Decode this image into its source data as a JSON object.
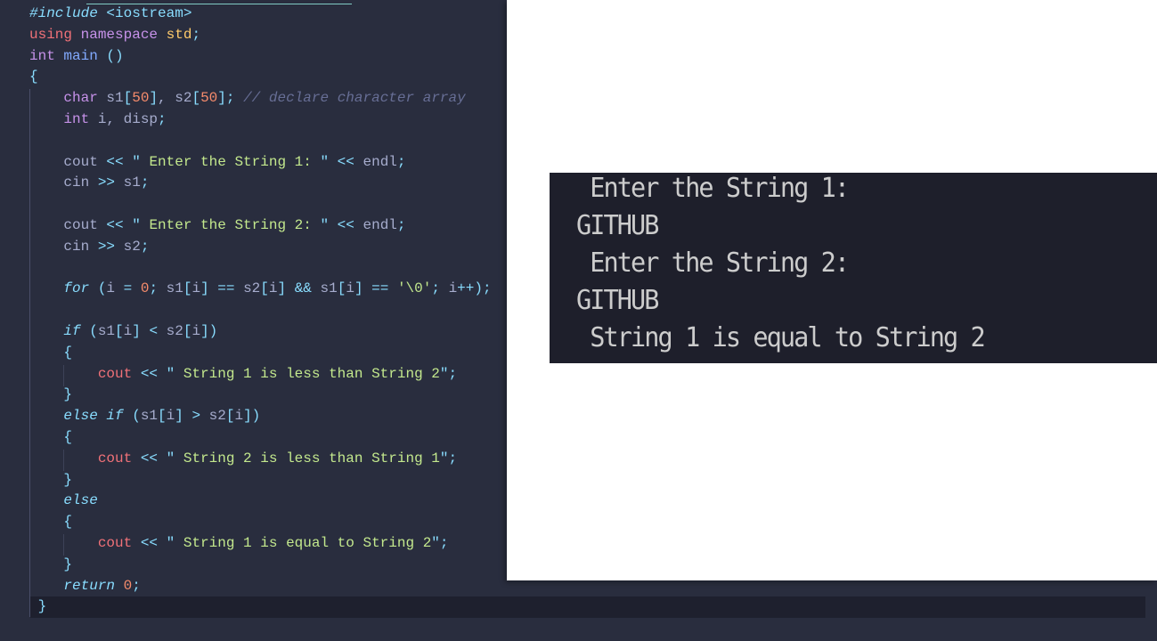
{
  "editor": {
    "colors": {
      "background": "#292d3e",
      "keyword": "#c792ea",
      "string": "#c3e88d",
      "number": "#f78c6c",
      "comment": "#676e95",
      "punctuation": "#89ddff"
    },
    "lines": [
      [
        [
          "#include ",
          "ctl"
        ],
        [
          "<iostream>",
          "pun"
        ]
      ],
      [
        [
          "using ",
          "red"
        ],
        [
          "namespace ",
          "kw"
        ],
        [
          "std",
          "yel"
        ],
        [
          ";",
          "pun"
        ]
      ],
      [
        [
          "int ",
          "kw"
        ],
        [
          "main ",
          "fn"
        ],
        [
          "()",
          "pun"
        ]
      ],
      [
        [
          "{",
          "pun"
        ]
      ],
      [
        [
          "    ",
          " "
        ],
        [
          "char ",
          "kw"
        ],
        [
          "s1",
          "var"
        ],
        [
          "[",
          "pun"
        ],
        [
          "50",
          "num"
        ],
        [
          "]",
          "pun"
        ],
        [
          ", s2",
          "var"
        ],
        [
          "[",
          "pun"
        ],
        [
          "50",
          "num"
        ],
        [
          "]",
          "pun"
        ],
        [
          "; ",
          "pun"
        ],
        [
          "// declare character array",
          "cmt"
        ]
      ],
      [
        [
          "    ",
          " "
        ],
        [
          "int ",
          "kw"
        ],
        [
          "i, disp",
          "var"
        ],
        [
          ";",
          "pun"
        ]
      ],
      [],
      [
        [
          "    cout ",
          "var"
        ],
        [
          "<< ",
          "pun"
        ],
        [
          "\" ",
          "pun"
        ],
        [
          "Enter the String 1: ",
          "str"
        ],
        [
          "\" ",
          "pun"
        ],
        [
          "<< ",
          "pun"
        ],
        [
          "endl",
          "var"
        ],
        [
          ";",
          "pun"
        ]
      ],
      [
        [
          "    cin ",
          "var"
        ],
        [
          ">> ",
          "pun"
        ],
        [
          "s1",
          "var"
        ],
        [
          ";",
          "pun"
        ]
      ],
      [],
      [
        [
          "    cout ",
          "var"
        ],
        [
          "<< ",
          "pun"
        ],
        [
          "\" ",
          "pun"
        ],
        [
          "Enter the String 2: ",
          "str"
        ],
        [
          "\" ",
          "pun"
        ],
        [
          "<< ",
          "pun"
        ],
        [
          "endl",
          "var"
        ],
        [
          ";",
          "pun"
        ]
      ],
      [
        [
          "    cin ",
          "var"
        ],
        [
          ">> ",
          "pun"
        ],
        [
          "s2",
          "var"
        ],
        [
          ";",
          "pun"
        ]
      ],
      [],
      [
        [
          "    ",
          " "
        ],
        [
          "for ",
          "ctl"
        ],
        [
          "(",
          "pun"
        ],
        [
          "i ",
          "var"
        ],
        [
          "= ",
          "pun"
        ],
        [
          "0",
          "num"
        ],
        [
          "; ",
          "pun"
        ],
        [
          "s1",
          "var"
        ],
        [
          "[",
          "pun"
        ],
        [
          "i",
          "var"
        ],
        [
          "] ",
          "pun"
        ],
        [
          "== ",
          "pun"
        ],
        [
          "s2",
          "var"
        ],
        [
          "[",
          "pun"
        ],
        [
          "i",
          "var"
        ],
        [
          "] ",
          "pun"
        ],
        [
          "&& ",
          "pun"
        ],
        [
          "s1",
          "var"
        ],
        [
          "[",
          "pun"
        ],
        [
          "i",
          "var"
        ],
        [
          "] ",
          "pun"
        ],
        [
          "== ",
          "pun"
        ],
        [
          "'\\0'",
          "str"
        ],
        [
          "; ",
          "pun"
        ],
        [
          "i",
          "var"
        ],
        [
          "++",
          "pun"
        ],
        [
          ");",
          "pun"
        ]
      ],
      [],
      [
        [
          "    ",
          " "
        ],
        [
          "if ",
          "ctl"
        ],
        [
          "(",
          "pun"
        ],
        [
          "s1",
          "var"
        ],
        [
          "[",
          "pun"
        ],
        [
          "i",
          "var"
        ],
        [
          "] ",
          "pun"
        ],
        [
          "< ",
          "pun"
        ],
        [
          "s2",
          "var"
        ],
        [
          "[",
          "pun"
        ],
        [
          "i",
          "var"
        ],
        [
          "])",
          "pun"
        ]
      ],
      [
        [
          "    {",
          "pun"
        ]
      ],
      [
        [
          "        ",
          " "
        ],
        [
          "cout ",
          "red"
        ],
        [
          "<< ",
          "pun"
        ],
        [
          "\" ",
          "pun"
        ],
        [
          "String 1 is less than String 2",
          "str"
        ],
        [
          "\";",
          "pun"
        ]
      ],
      [
        [
          "    }",
          "pun"
        ]
      ],
      [
        [
          "    ",
          " "
        ],
        [
          "else if ",
          "ctl"
        ],
        [
          "(",
          "pun"
        ],
        [
          "s1",
          "var"
        ],
        [
          "[",
          "pun"
        ],
        [
          "i",
          "var"
        ],
        [
          "] ",
          "pun"
        ],
        [
          "> ",
          "pun"
        ],
        [
          "s2",
          "var"
        ],
        [
          "[",
          "pun"
        ],
        [
          "i",
          "var"
        ],
        [
          "])",
          "pun"
        ]
      ],
      [
        [
          "    {",
          "pun"
        ]
      ],
      [
        [
          "        ",
          " "
        ],
        [
          "cout ",
          "red"
        ],
        [
          "<< ",
          "pun"
        ],
        [
          "\" ",
          "pun"
        ],
        [
          "String 2 is less than String 1",
          "str"
        ],
        [
          "\";",
          "pun"
        ]
      ],
      [
        [
          "    }",
          "pun"
        ]
      ],
      [
        [
          "    ",
          " "
        ],
        [
          "else",
          "ctl"
        ]
      ],
      [
        [
          "    {",
          "pun"
        ]
      ],
      [
        [
          "        ",
          " "
        ],
        [
          "cout ",
          "red"
        ],
        [
          "<< ",
          "pun"
        ],
        [
          "\" ",
          "pun"
        ],
        [
          "String 1 is equal to String 2",
          "str"
        ],
        [
          "\";",
          "pun"
        ]
      ],
      [
        [
          "    }",
          "pun"
        ]
      ],
      [
        [
          "    ",
          " "
        ],
        [
          "return ",
          "ctl"
        ],
        [
          "0",
          "num"
        ],
        [
          ";",
          "pun"
        ]
      ],
      [
        [
          " }",
          "pun"
        ]
      ]
    ]
  },
  "terminal": {
    "lines": [
      " Enter the String 1:",
      "GITHUB",
      " Enter the String 2:",
      "GITHUB",
      " String 1 is equal to String 2"
    ]
  }
}
